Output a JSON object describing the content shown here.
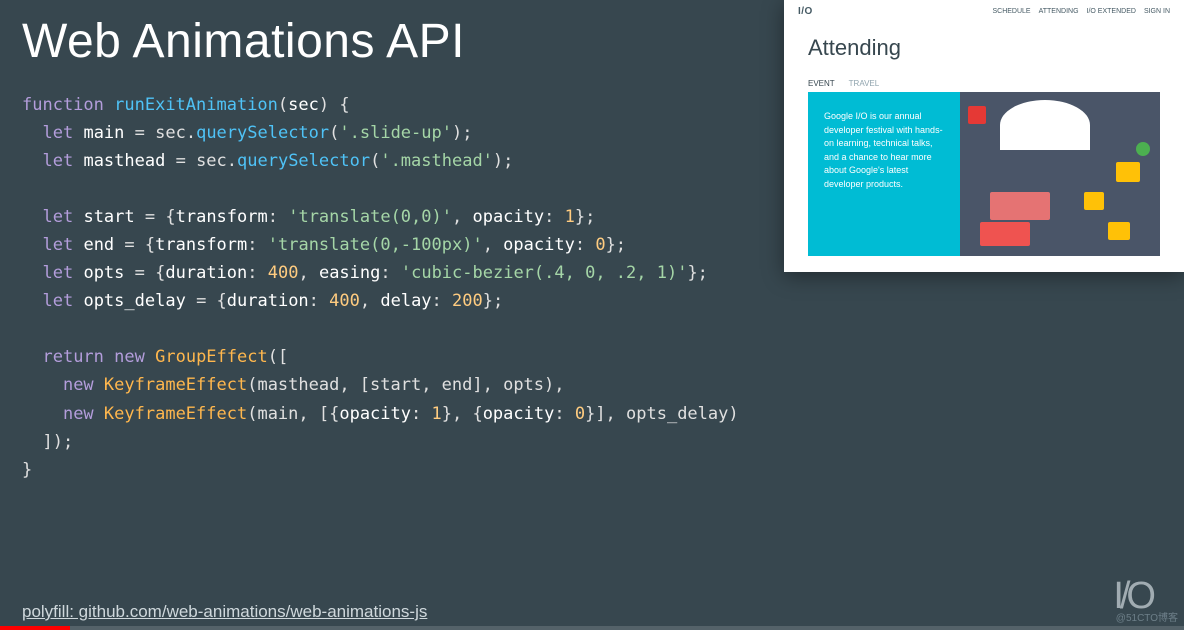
{
  "slide": {
    "title": "Web Animations API",
    "polyfill_label": "polyfill: github.com/web-animations/web-animations-js"
  },
  "code": {
    "kw_function": "function",
    "fn_name": "runExitAnimation",
    "param": "sec",
    "kw_let": "let",
    "var_main": "main",
    "var_masthead": "masthead",
    "var_start": "start",
    "var_end": "end",
    "var_opts": "opts",
    "var_opts_delay": "opts_delay",
    "method_qs": "querySelector",
    "sel_slideup": "'.slide-up'",
    "sel_masthead": "'.masthead'",
    "prop_transform": "transform",
    "prop_opacity": "opacity",
    "prop_duration": "duration",
    "prop_easing": "easing",
    "prop_delay": "delay",
    "val_translate0": "'translate(0,0)'",
    "val_translate100": "'translate(0,-100px)'",
    "val_bezier": "'cubic-bezier(.4, 0, .2, 1)'",
    "num_1": "1",
    "num_0": "0",
    "num_400": "400",
    "num_200": "200",
    "kw_return": "return",
    "kw_new": "new",
    "cls_group": "GroupEffect",
    "cls_keyframe": "KeyframeEffect"
  },
  "inset": {
    "logo": "I/O",
    "nav": [
      "SCHEDULE",
      "ATTENDING",
      "I/O EXTENDED",
      "SIGN IN"
    ],
    "title": "Attending",
    "tabs": [
      "EVENT",
      "TRAVEL"
    ],
    "blurb": "Google I/O is our annual developer festival with hands-on learning, technical talks, and a chance to hear more about Google's latest developer products."
  },
  "footer": {
    "io_logo": "I/O",
    "watermark": "@51CTO博客"
  }
}
